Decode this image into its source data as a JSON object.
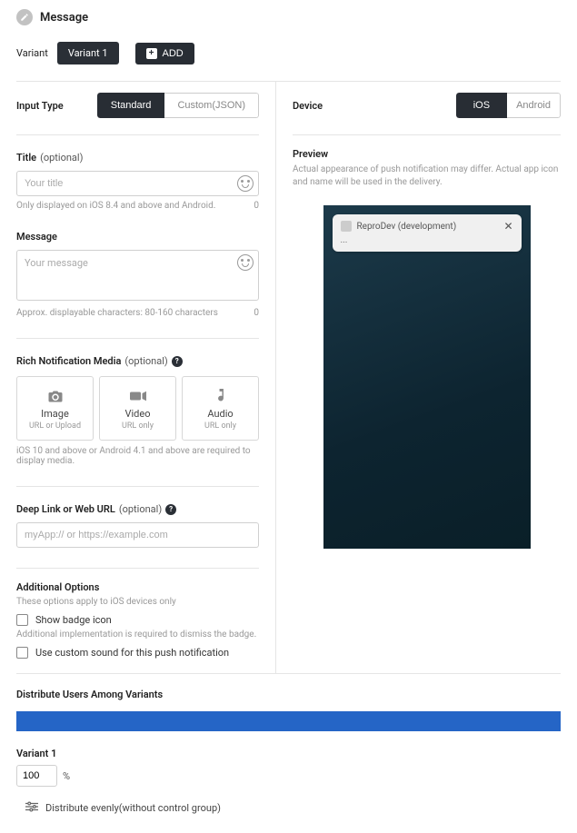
{
  "header": {
    "title": "Message"
  },
  "variant_row": {
    "label": "Variant",
    "chip": "Variant 1",
    "add_label": "ADD"
  },
  "left": {
    "input_type_label": "Input Type",
    "toggle": {
      "standard": "Standard",
      "custom": "Custom(JSON)"
    },
    "title_field": {
      "label": "Title",
      "optional": "(optional)",
      "placeholder": "Your title",
      "helper": "Only displayed on iOS 8.4 and above and Android.",
      "counter": "0"
    },
    "message_field": {
      "label": "Message",
      "placeholder": "Your message",
      "helper": "Approx. displayable characters: 80-160 characters",
      "counter": "0"
    },
    "media": {
      "label": "Rich Notification Media",
      "optional": "(optional)",
      "cards": [
        {
          "title": "Image",
          "sub": "URL or Upload"
        },
        {
          "title": "Video",
          "sub": "URL only"
        },
        {
          "title": "Audio",
          "sub": "URL only"
        }
      ],
      "helper": "iOS 10 and above or Android 4.1 and above are required to display media."
    },
    "deeplink": {
      "label": "Deep Link or Web URL",
      "optional": "(optional)",
      "placeholder": "myApp:// or https://example.com"
    },
    "additional": {
      "label": "Additional Options",
      "sub": "These options apply to iOS devices only",
      "badge_label": "Show badge icon",
      "badge_helper": "Additional implementation is required to dismiss the badge.",
      "sound_label": "Use custom sound for this push notification"
    }
  },
  "right": {
    "device_label": "Device",
    "toggle": {
      "ios": "iOS",
      "android": "Android"
    },
    "preview_label": "Preview",
    "preview_desc": "Actual appearance of push notification may differ. Actual app icon and name will be used in the delivery.",
    "notif": {
      "app_name": "ReproDev (development)",
      "body": "..."
    }
  },
  "distribute": {
    "title": "Distribute Users Among Variants",
    "variant_label": "Variant 1",
    "percent_value": "100",
    "percent_sign": "%",
    "evenly_label": "Distribute evenly(without control group)"
  }
}
